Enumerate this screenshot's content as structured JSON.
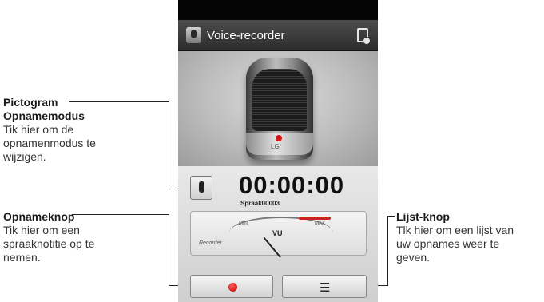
{
  "app": {
    "title": "Voice-recorder",
    "timer": "00:00:00",
    "filename": "Spraak00003",
    "vu_label": "VU",
    "vu_min": "MIN",
    "vu_max": "MAX",
    "mic_brand": "LG",
    "vu_brand": "Recorder",
    "list_glyph": "☰"
  },
  "annotations": {
    "mode": {
      "title_line1": "Pictogram",
      "title_line2": "Opnamemodus",
      "desc": [
        "Tik hier om de",
        "opnamenmodus te",
        "wijzigen."
      ]
    },
    "record": {
      "title": "Opnameknop",
      "desc": [
        "Tik hier om een",
        "spraaknotitie op te",
        "nemen."
      ]
    },
    "list": {
      "title": "Lijst-knop",
      "desc": [
        "Tlk hier om een lijst van",
        "uw opnames weer te",
        "geven."
      ]
    }
  }
}
